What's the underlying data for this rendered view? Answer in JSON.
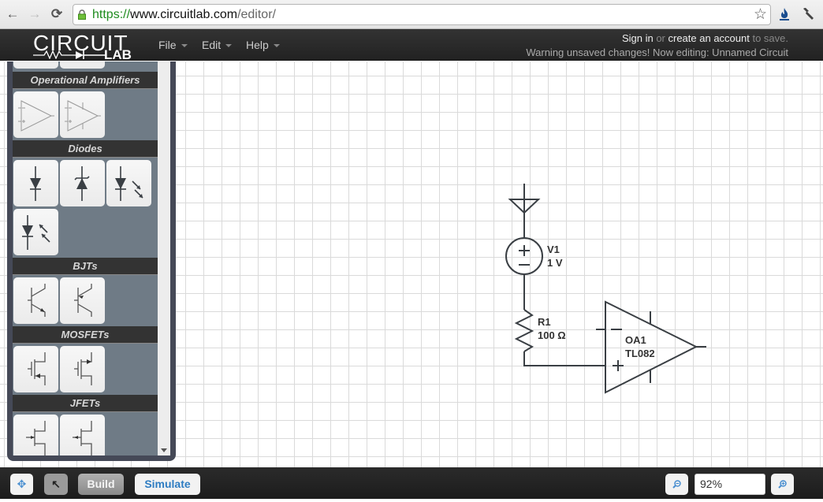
{
  "browser": {
    "url_protocol": "https://",
    "url_host": "www.circuitlab.com",
    "url_path": "/editor/",
    "back_icon": "←",
    "forward_icon": "→",
    "reload_icon": "⟳",
    "star_icon": "☆",
    "flame_icon": "🔥",
    "wrench_icon": "🔧"
  },
  "header": {
    "logo_top": "CIRCUIT",
    "logo_bottom": "LAB",
    "menus": [
      {
        "label": "File"
      },
      {
        "label": "Edit"
      },
      {
        "label": "Help"
      }
    ],
    "sign_in": "Sign in",
    "or": " or ",
    "create_account": "create an account",
    "to_save": " to save.",
    "warning": "Warning unsaved changes! Now editing: Unnamed Circuit"
  },
  "sidebar": {
    "categories": [
      {
        "label": "Operational Amplifiers",
        "items": [
          "Op-amp (3 pin)",
          "Op-amp (5 pin)"
        ]
      },
      {
        "label": "Diodes",
        "items": [
          "Diode",
          "Zener diode",
          "LED",
          "Photodiode"
        ]
      },
      {
        "label": "BJTs",
        "items": [
          "NPN transistor",
          "PNP transistor"
        ]
      },
      {
        "label": "MOSFETs",
        "items": [
          "N-channel MOSFET",
          "P-channel MOSFET"
        ]
      },
      {
        "label": "JFETs",
        "items": [
          "N-channel JFET",
          "P-channel JFET"
        ]
      }
    ]
  },
  "circuit": {
    "v1": {
      "name": "V1",
      "value": "1 V"
    },
    "r1": {
      "name": "R1",
      "value": "100 Ω"
    },
    "oa1": {
      "name": "OA1",
      "value": "TL082"
    }
  },
  "bottombar": {
    "pan_icon": "✥",
    "select_icon": "↖",
    "build": "Build",
    "simulate": "Simulate",
    "zoom_out_icon": "🔍-",
    "zoom_in_icon": "🔍+",
    "zoom_value": "92%"
  }
}
